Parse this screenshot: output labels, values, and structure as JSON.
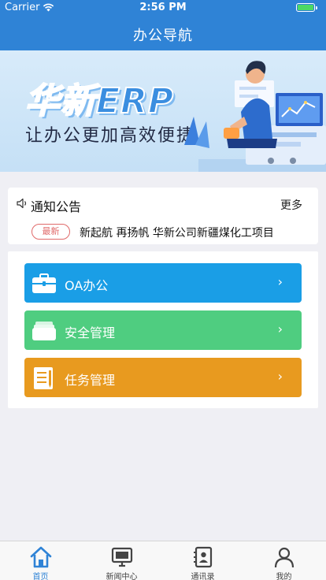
{
  "status_bar": {
    "carrier": "Carrier",
    "time": "2:56 PM",
    "wifi_icon": "wifi-icon",
    "battery_icon": "battery-icon"
  },
  "nav": {
    "title": "办公导航"
  },
  "banner": {
    "title": "华新ERP",
    "subtitle": "让办公更加高效便捷",
    "illustration": "person-with-laptop-illustration"
  },
  "notice": {
    "icon": "speaker-icon",
    "title": "通知公告",
    "more": "更多",
    "tag": "最新",
    "headline": "新起航 再扬帆 华新公司新疆煤化工项目"
  },
  "menu": {
    "items": [
      {
        "label": "OA办公",
        "icon": "briefcase-icon",
        "color": "#1a9ee6",
        "arrow": "›"
      },
      {
        "label": "安全管理",
        "icon": "folder-stack-icon",
        "color": "#4fcd80",
        "arrow": "›"
      },
      {
        "label": "任务管理",
        "icon": "notepad-icon",
        "color": "#e89a1f",
        "arrow": "›"
      }
    ]
  },
  "tabbar": {
    "active_color": "#2f83d6",
    "tabs": [
      {
        "label": "首页",
        "icon": "home-icon",
        "active": true
      },
      {
        "label": "新闻中心",
        "icon": "monitor-icon",
        "active": false
      },
      {
        "label": "通讯录",
        "icon": "contacts-icon",
        "active": false
      },
      {
        "label": "我的",
        "icon": "profile-icon",
        "active": false
      }
    ]
  },
  "colors": {
    "nav_bar": "#2f83d6",
    "page_bg": "#efeff4"
  }
}
